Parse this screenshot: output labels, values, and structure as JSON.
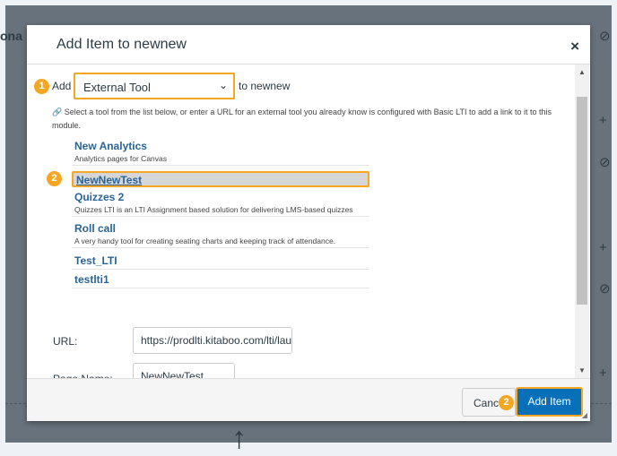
{
  "background": {
    "partial_text": "ona"
  },
  "modal": {
    "title": "Add Item to newnew",
    "close_label": "×",
    "step1": "1",
    "add_prefix": "Add",
    "item_type": "External Tool",
    "add_suffix": "to newnew",
    "help_text": "Select a tool from the list below, or enter a URL for an external tool you already know is configured with Basic LTI to add a link to it to this module.",
    "step2": "2",
    "tools": [
      {
        "name": "New Analytics",
        "desc": "Analytics pages for Canvas"
      },
      {
        "name": "NewNewTest",
        "desc": "",
        "selected": true
      },
      {
        "name": "Quizzes 2",
        "desc": "Quizzes LTI is an LTI Assignment based solution for delivering LMS-based quizzes"
      },
      {
        "name": "Roll call",
        "desc": "A very handy tool for creating seating charts and keeping track of attendance."
      },
      {
        "name": "Test_LTI",
        "desc": ""
      },
      {
        "name": "testlti1",
        "desc": ""
      }
    ],
    "url_label": "URL:",
    "url_value": "https://prodlti.kitaboo.com/lti/lau",
    "page_name_label": "Page Name:",
    "page_name_value": "NewNewTest",
    "cancel_label": "Cancel",
    "add_item_label": "Add Item"
  },
  "colors": {
    "accent": "#f5a623",
    "primary": "#0770b8",
    "link": "#2a6496"
  }
}
